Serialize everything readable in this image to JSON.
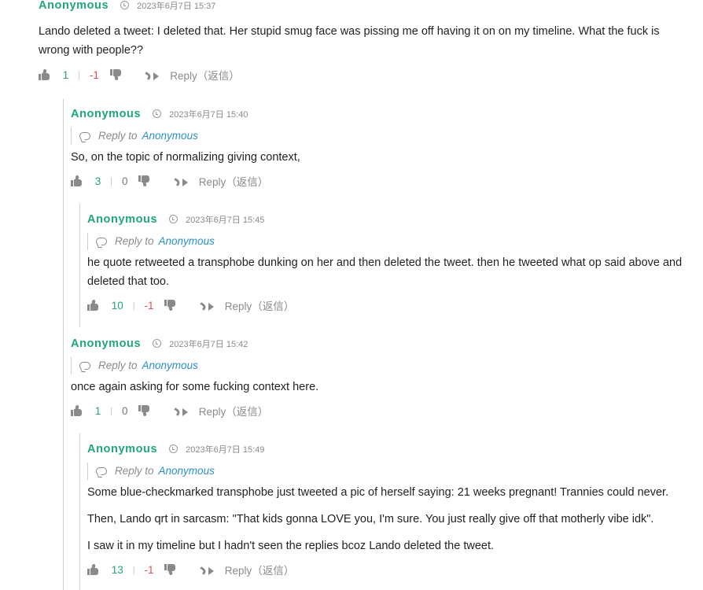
{
  "comments": [
    {
      "author": "Anonymous",
      "date": "2023年6月7日 15:37",
      "lines": [
        "Lando deleted a tweet: I deleted that. Her stupid smug face was pissing me off having it on on my timeline. What the fuck is",
        "wrong with people??"
      ],
      "up": "1",
      "down": "-1",
      "reply": "Reply（返信）"
    },
    {
      "author": "Anonymous",
      "date": "2023年6月7日 15:40",
      "reply_to_prefix": "Reply to",
      "reply_to": "Anonymous",
      "lines": [
        "So, on the topic of normalizing giving context,"
      ],
      "up": "3",
      "down": "0",
      "reply": "Reply（返信）"
    },
    {
      "author": "Anonymous",
      "date": "2023年6月7日 15:45",
      "reply_to_prefix": "Reply to",
      "reply_to": "Anonymous",
      "lines": [
        "he quote retweeted a transphobe dunking on her and then deleted the tweet. then he tweeted what op said above and",
        "deleted that too."
      ],
      "up": "10",
      "down": "-1",
      "reply": "Reply（返信）"
    },
    {
      "author": "Anonymous",
      "date": "2023年6月7日 15:42",
      "reply_to_prefix": "Reply to",
      "reply_to": "Anonymous",
      "lines": [
        "once again asking for some fucking context here."
      ],
      "up": "1",
      "down": "0",
      "reply": "Reply（返信）"
    },
    {
      "author": "Anonymous",
      "date": "2023年6月7日 15:49",
      "reply_to_prefix": "Reply to",
      "reply_to": "Anonymous",
      "lines": [
        "Some blue-checkmarked transphobe just tweeted a pic of herself saying: 21 weeks pregnant! Trannies could never.",
        "Then, Lando qrt in sarcasm: \"That kids gonna LOVE you, I'm sure. You just really give off that motherly vibe idk\".",
        "I saw it in my timeline but I hadn't seen the replies bcoz Lando deleted the tweet."
      ],
      "up": "13",
      "down": "-1",
      "reply": "Reply（返信）"
    }
  ],
  "colors": {
    "author": "#1fa67a",
    "upvote": "#1fa67a",
    "downvote": "#e04d4d",
    "link": "#2a8fc6",
    "muted": "#8a8a8a"
  },
  "icons": [
    "clock-icon",
    "reply-bubble-icon",
    "thumbs-up-icon",
    "thumbs-down-icon",
    "reply-arrow-icon"
  ]
}
